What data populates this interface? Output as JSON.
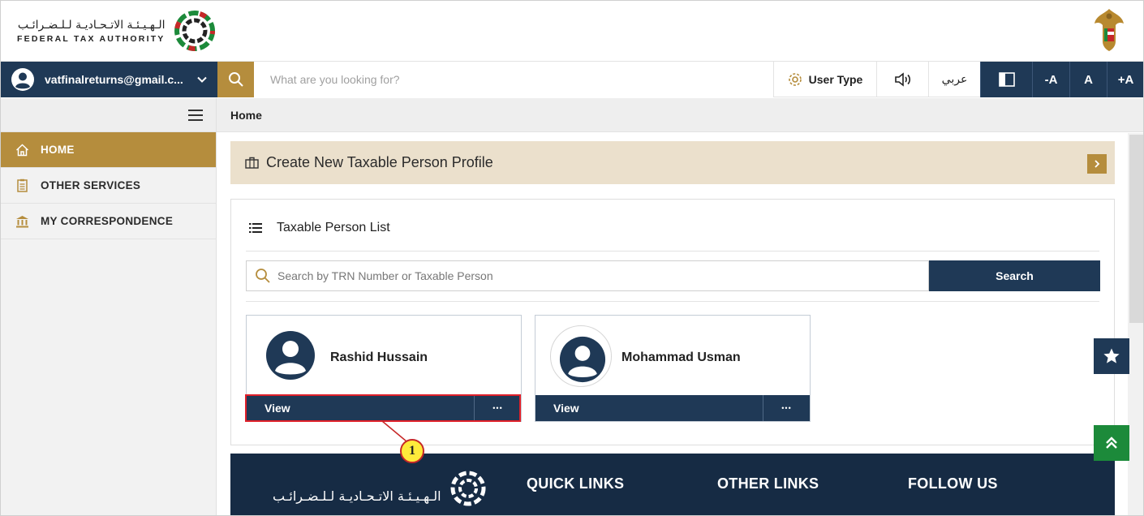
{
  "header": {
    "org_name_ar": "الـهـيـئـة الاتـحـاديـة لـلـضـرائـب",
    "org_name_en": "FEDERAL TAX AUTHORITY",
    "logo_icon": "fta-logo-icon",
    "emblem_icon": "uae-emblem-icon"
  },
  "toolbar": {
    "user_email": "vatfinalreturns@gmail.c...",
    "search_placeholder": "What are you looking for?",
    "user_type_label": "User Type",
    "language_label": "عربي",
    "font_decrease": "-A",
    "font_normal": "A",
    "font_increase": "+A"
  },
  "sidebar": {
    "items": [
      {
        "label": "HOME",
        "icon": "home-icon",
        "active": true
      },
      {
        "label": "OTHER SERVICES",
        "icon": "clipboard-icon",
        "active": false
      },
      {
        "label": "MY CORRESPONDENCE",
        "icon": "bank-icon",
        "active": false
      }
    ]
  },
  "breadcrumb": {
    "current": "Home"
  },
  "create_banner": {
    "label": "Create New Taxable Person Profile"
  },
  "taxable_list": {
    "title": "Taxable Person List",
    "search_placeholder": "Search by TRN Number or Taxable Person",
    "search_button": "Search",
    "cards": [
      {
        "name": "Rashid Hussain",
        "view_label": "View",
        "more_label": "•••"
      },
      {
        "name": "Mohammad Usman",
        "view_label": "View",
        "more_label": "•••"
      }
    ]
  },
  "callout": {
    "number": "1"
  },
  "footer": {
    "org_name_ar": "الـهـيـئـة الاتـحـاديـة لـلـضـرائـب",
    "quick_links": "QUICK LINKS",
    "other_links": "OTHER LINKS",
    "follow_us": "FOLLOW US"
  },
  "colors": {
    "navy": "#1f3956",
    "gold": "#b58d3d",
    "banner_beige": "#ebe0cc",
    "green": "#1c8a3a",
    "highlight_red": "#e0202a"
  }
}
